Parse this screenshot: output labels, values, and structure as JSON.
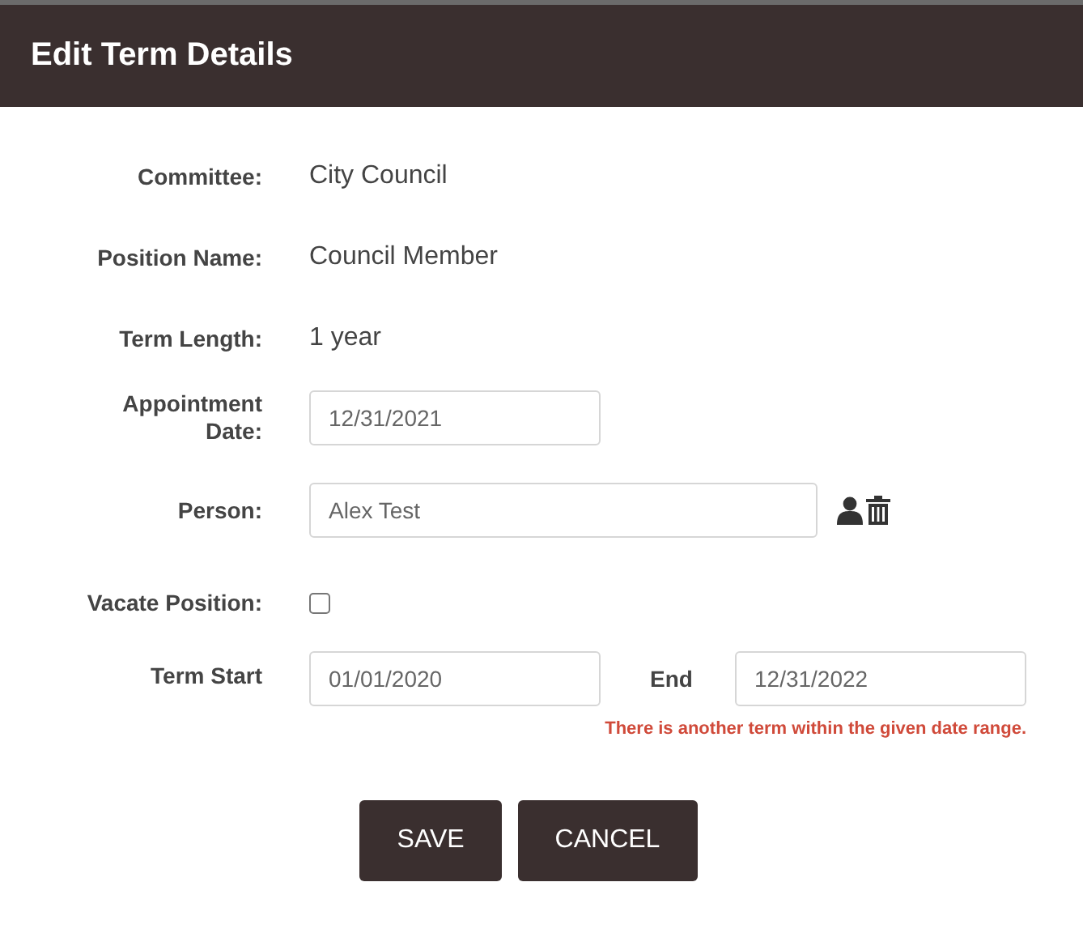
{
  "dialog": {
    "title": "Edit Term Details"
  },
  "fields": [
    {
      "kind": "text",
      "label": "Committee:",
      "value": "City Council"
    },
    {
      "kind": "text",
      "label": "Position Name:",
      "value": "Council Member"
    },
    {
      "kind": "text",
      "label": "Term Length:",
      "value": "1 year"
    },
    {
      "kind": "date",
      "label": "Appointment Date:",
      "value": "12/31/2021"
    },
    {
      "kind": "person",
      "label": "Person:",
      "value": "Alex Test"
    },
    {
      "kind": "checkbox",
      "label": "Vacate Position:",
      "checked": false
    },
    {
      "kind": "range",
      "label": "Term Start",
      "value": "01/01/2020",
      "end_label": "End",
      "end_value": "12/31/2022",
      "error": "There is another term within the given date range."
    }
  ],
  "buttons": [
    "SAVE",
    "CANCEL"
  ]
}
